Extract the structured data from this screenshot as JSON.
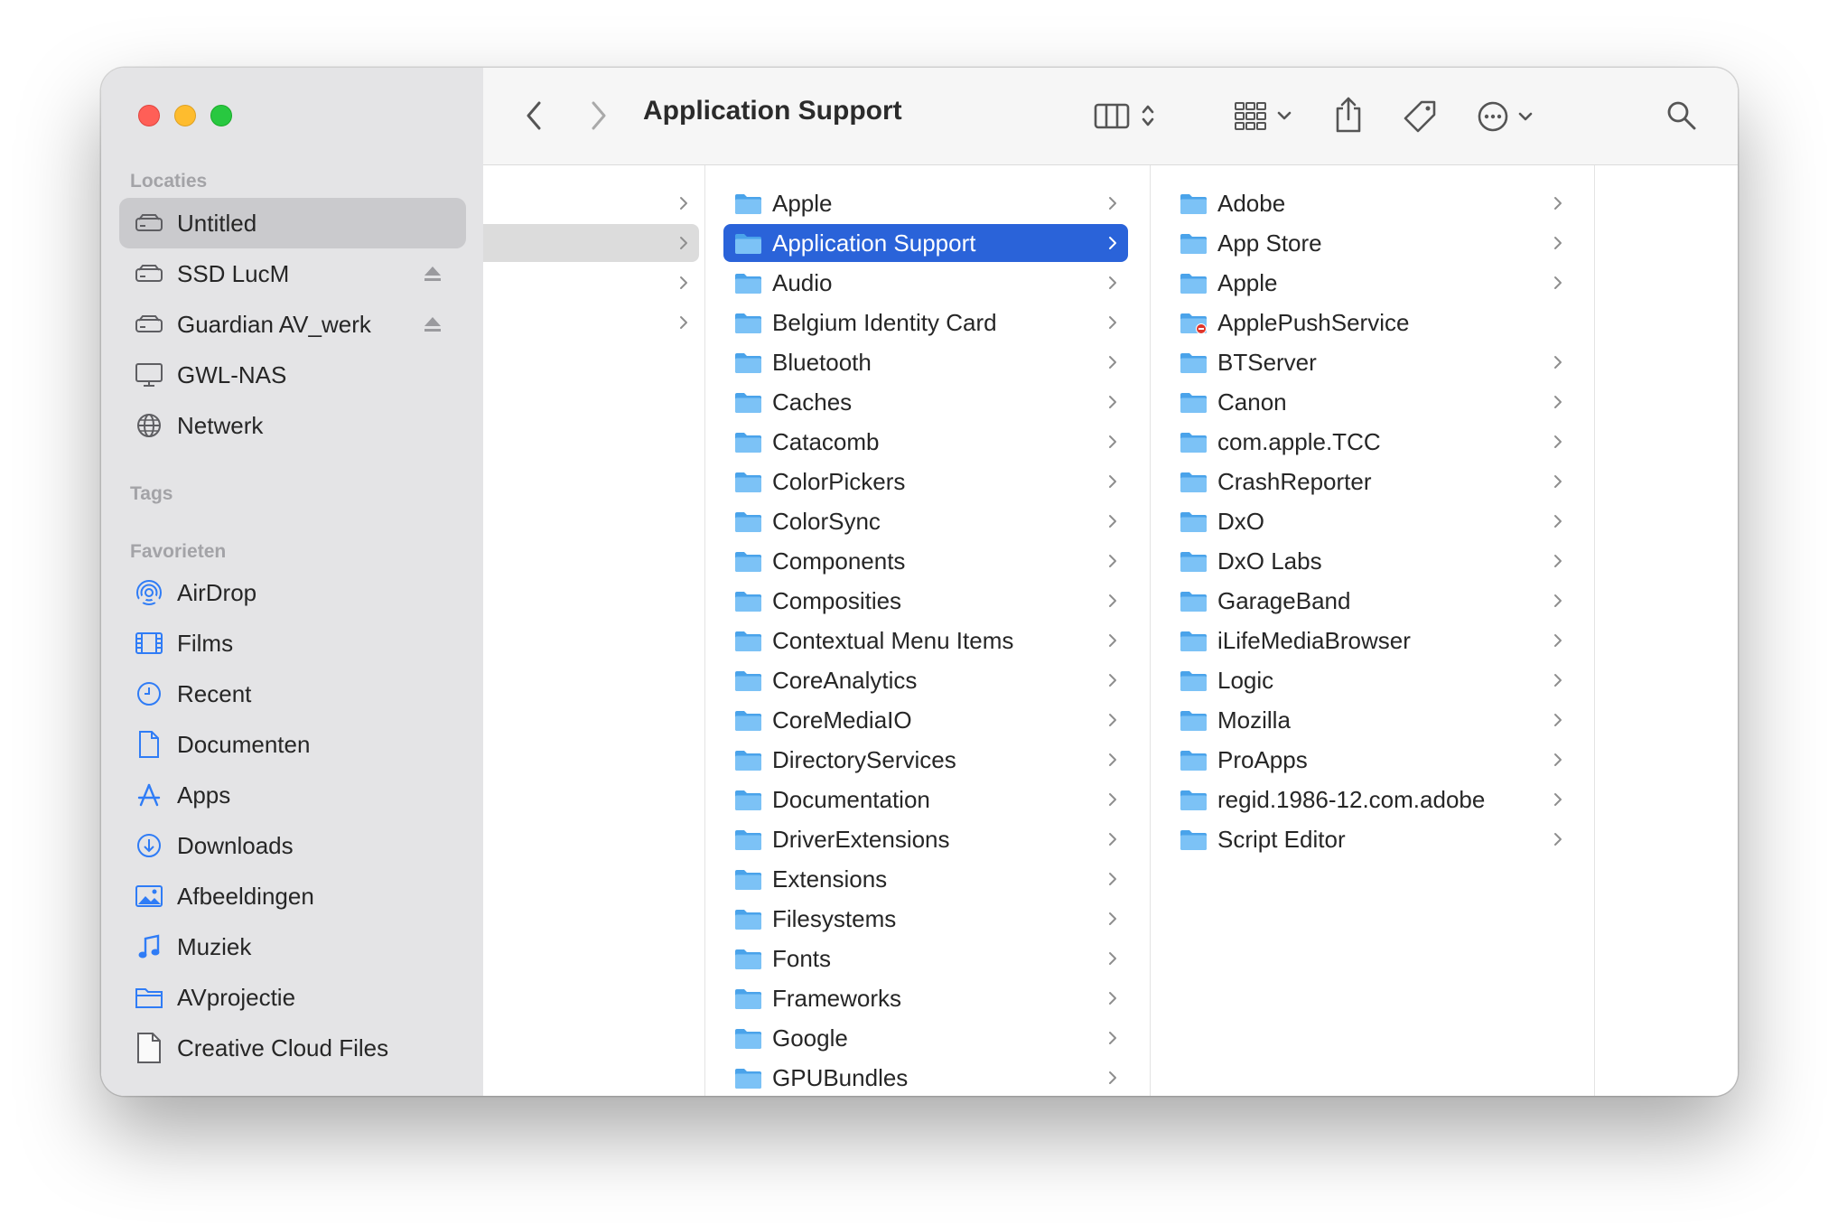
{
  "window": {
    "title": "Application Support"
  },
  "sidebar": {
    "sections": [
      {
        "heading": "Locaties",
        "items": [
          {
            "label": "Untitled",
            "icon": "drive-icon",
            "selected": true,
            "eject": false
          },
          {
            "label": "SSD LucM",
            "icon": "drive-icon",
            "selected": false,
            "eject": true
          },
          {
            "label": "Guardian AV_werk",
            "icon": "drive-icon",
            "selected": false,
            "eject": true
          },
          {
            "label": "GWL-NAS",
            "icon": "monitor-icon",
            "selected": false,
            "eject": false
          },
          {
            "label": "Netwerk",
            "icon": "globe-icon",
            "selected": false,
            "eject": false
          }
        ]
      },
      {
        "heading": "Tags",
        "items": []
      },
      {
        "heading": "Favorieten",
        "items": [
          {
            "label": "AirDrop",
            "icon": "airdrop-icon"
          },
          {
            "label": "Films",
            "icon": "film-icon"
          },
          {
            "label": "Recent",
            "icon": "clock-icon"
          },
          {
            "label": "Documenten",
            "icon": "document-icon"
          },
          {
            "label": "Apps",
            "icon": "apps-icon"
          },
          {
            "label": "Downloads",
            "icon": "download-icon"
          },
          {
            "label": "Afbeeldingen",
            "icon": "photo-icon"
          },
          {
            "label": "Muziek",
            "icon": "music-icon"
          },
          {
            "label": "AVprojectie",
            "icon": "folder-outline-icon"
          },
          {
            "label": "Creative Cloud Files",
            "icon": "file-icon"
          }
        ]
      }
    ]
  },
  "toolbar": {
    "back": "chevron-left-icon",
    "forward": "chevron-right-icon",
    "view": "column-view-icon",
    "group": "group-icon",
    "share": "share-icon",
    "tag": "tag-icon",
    "more": "more-icon",
    "search": "search-icon"
  },
  "columns": {
    "col1": {
      "rows": 4,
      "selected_index": 1
    },
    "col2": {
      "selected": "Application Support",
      "items": [
        "Apple",
        "Application Support",
        "Audio",
        "Belgium Identity Card",
        "Bluetooth",
        "Caches",
        "Catacomb",
        "ColorPickers",
        "ColorSync",
        "Components",
        "Composities",
        "Contextual Menu Items",
        "CoreAnalytics",
        "CoreMediaIO",
        "DirectoryServices",
        "Documentation",
        "DriverExtensions",
        "Extensions",
        "Filesystems",
        "Fonts",
        "Frameworks",
        "Google",
        "GPUBundles"
      ]
    },
    "col3": {
      "items": [
        {
          "name": "Adobe",
          "chevron": true
        },
        {
          "name": "App Store",
          "chevron": true
        },
        {
          "name": "Apple",
          "chevron": true
        },
        {
          "name": "ApplePushService",
          "chevron": false,
          "restricted": true
        },
        {
          "name": "BTServer",
          "chevron": true
        },
        {
          "name": "Canon",
          "chevron": true
        },
        {
          "name": "com.apple.TCC",
          "chevron": true
        },
        {
          "name": "CrashReporter",
          "chevron": true
        },
        {
          "name": "DxO",
          "chevron": true
        },
        {
          "name": "DxO Labs",
          "chevron": true
        },
        {
          "name": "GarageBand",
          "chevron": true
        },
        {
          "name": "iLifeMediaBrowser",
          "chevron": true
        },
        {
          "name": "Logic",
          "chevron": true
        },
        {
          "name": "Mozilla",
          "chevron": true
        },
        {
          "name": "ProApps",
          "chevron": true
        },
        {
          "name": "regid.1986-12.com.adobe",
          "chevron": true
        },
        {
          "name": "Script Editor",
          "chevron": true
        }
      ]
    }
  },
  "colors": {
    "accent": "#2a63d9",
    "folder": "#5aaef0",
    "sidebar_icon": "#2f7cf6"
  }
}
